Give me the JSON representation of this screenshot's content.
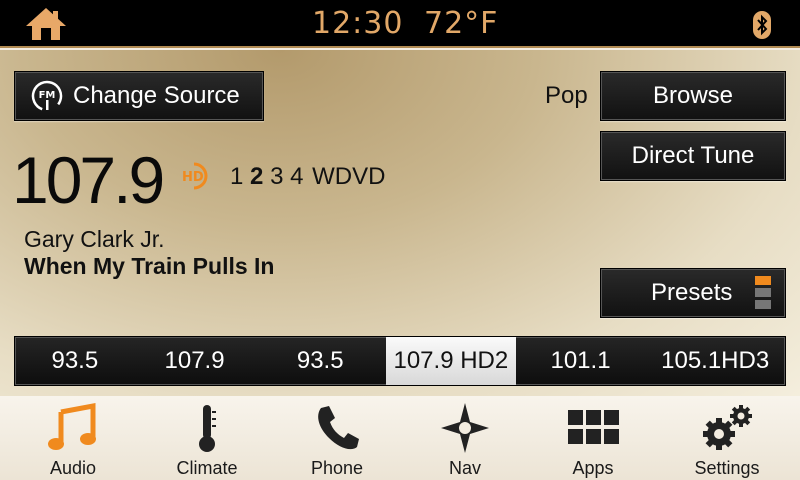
{
  "status": {
    "time": "12:30",
    "temperature": "72°F",
    "icons": {
      "home": "home-icon",
      "bluetooth": "bluetooth-icon"
    }
  },
  "source": {
    "change_source_label": "Change Source",
    "icon": "fm-radio-icon"
  },
  "station": {
    "genre": "Pop",
    "frequency": "107.9",
    "hd_icon": "hd-radio-icon",
    "subchannels": [
      "1",
      "2",
      "3",
      "4"
    ],
    "active_subchannel": "2",
    "callsign": "WDVD",
    "artist": "Gary Clark Jr.",
    "track": "When My Train Pulls In"
  },
  "actions": {
    "browse_label": "Browse",
    "direct_tune_label": "Direct Tune",
    "presets_label": "Presets"
  },
  "presets": [
    {
      "label": "93.5",
      "selected": false
    },
    {
      "label": "107.9",
      "selected": false
    },
    {
      "label": "93.5",
      "selected": false
    },
    {
      "label": "107.9 HD2",
      "selected": true
    },
    {
      "label": "101.1",
      "selected": false
    },
    {
      "label": "105.1HD3",
      "selected": false
    }
  ],
  "nav": [
    {
      "label": "Audio",
      "icon": "music-note-icon"
    },
    {
      "label": "Climate",
      "icon": "thermometer-icon"
    },
    {
      "label": "Phone",
      "icon": "phone-icon"
    },
    {
      "label": "Nav",
      "icon": "compass-icon"
    },
    {
      "label": "Apps",
      "icon": "apps-grid-icon"
    },
    {
      "label": "Settings",
      "icon": "gear-icon"
    }
  ],
  "colors": {
    "accent_orange": "#f08a1e",
    "status_text": "#e2a868",
    "button_dark": "#151515"
  }
}
